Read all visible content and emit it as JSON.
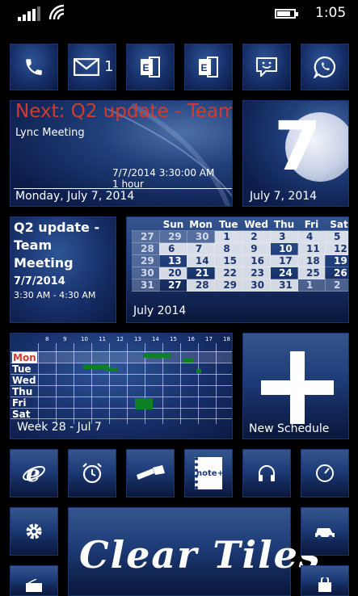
{
  "status_bar": {
    "time": "1:05"
  },
  "tiles": {
    "phone": {
      "icon": "phone-icon"
    },
    "messaging": {
      "icon": "mail-icon",
      "count": "1"
    },
    "exchange_1": {
      "icon": "exchange-icon"
    },
    "exchange_2": {
      "icon": "exchange-icon"
    },
    "chat": {
      "icon": "chat-icon"
    },
    "whatsapp": {
      "icon": "whatsapp-icon"
    },
    "next_meeting": {
      "title": "Next: Q2 update - Team",
      "location": "Lync Meeting",
      "start": "7/7/2014 3:30:00 AM",
      "duration": "1 hour",
      "date_line": "Monday, July 7, 2014"
    },
    "moon_date": {
      "day": "7",
      "date": "July 7, 2014"
    },
    "event": {
      "title_l1": "Q2 update -",
      "title_l2": "Team",
      "title_l3": "Meeting",
      "date": "7/7/2014",
      "time": "3:30 AM - 4:30 AM"
    },
    "month_calendar": {
      "weekdays": [
        "Sun",
        "Mon",
        "Tue",
        "Wed",
        "Thu",
        "Fri",
        "Sat"
      ],
      "weeks": [
        [
          "27",
          "29",
          "30",
          "1",
          "2",
          "3",
          "4",
          "5"
        ],
        [
          "28",
          "6",
          "7",
          "8",
          "9",
          "10",
          "11",
          "12"
        ],
        [
          "29",
          "13",
          "14",
          "15",
          "16",
          "17",
          "18",
          "19"
        ],
        [
          "30",
          "20",
          "21",
          "22",
          "23",
          "24",
          "25",
          "26"
        ],
        [
          "31",
          "27",
          "28",
          "29",
          "30",
          "31",
          "1",
          "2"
        ]
      ],
      "today": "7",
      "month_label": "July 2014"
    },
    "week_schedule": {
      "hours": [
        "8",
        "9",
        "10",
        "11",
        "12",
        "13",
        "14",
        "15",
        "16",
        "17",
        "18"
      ],
      "days": [
        "Mon",
        "Tue",
        "Wed",
        "Thu",
        "Fri",
        "Sat"
      ],
      "label": "Week 28 - Jul 7"
    },
    "new_schedule": {
      "label": "New Schedule"
    },
    "ie": {
      "icon": "internet-explorer-icon"
    },
    "alarm": {
      "icon": "alarm-clock-icon"
    },
    "flashlight": {
      "icon": "flashlight-icon"
    },
    "note": {
      "icon": "note-icon",
      "text": "note+"
    },
    "music": {
      "icon": "headphones-icon"
    },
    "speed": {
      "icon": "speedometer-icon"
    },
    "settings": {
      "icon": "gear-icon"
    },
    "clear_tiles": {
      "title": "Clear Tiles"
    },
    "car": {
      "icon": "car-icon"
    },
    "radio": {
      "icon": "radio-icon"
    },
    "store": {
      "icon": "store-bag-icon"
    }
  },
  "colors": {
    "accent_red": "#d63a2f",
    "event_green": "#0f7f24",
    "tile_blue": "#17306a"
  }
}
